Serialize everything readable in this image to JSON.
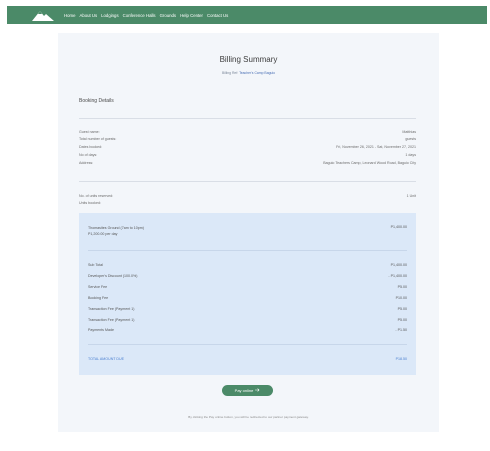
{
  "nav": {
    "logo_icon": "mountain-logo-icon",
    "items": [
      {
        "label": "Home"
      },
      {
        "label": "About Us"
      },
      {
        "label": "Lodgings"
      },
      {
        "label": "Conference Halls"
      },
      {
        "label": "Grounds"
      },
      {
        "label": "Help Center"
      },
      {
        "label": "Contact Us"
      }
    ]
  },
  "header": {
    "title": "Billing Summary",
    "subtitle_prefix": "Billing Ref: ",
    "reference": "Teacher's Camp Baguio"
  },
  "booking": {
    "section_label": "Booking Details",
    "rows": [
      {
        "label": "Guest name:",
        "value": "Matthias"
      },
      {
        "label": "Total number of guests:",
        "value": "guests"
      },
      {
        "label": "Dates booked:",
        "value": "Fri, November 26, 2021 - Sat, November 27, 2021"
      },
      {
        "label": "No of days:",
        "value": "1 days"
      },
      {
        "label": "Address:",
        "value": "Baguio Teachers Camp, Leonard Wood Road, Baguio City"
      }
    ],
    "units_reserved_label": "No. of units reserved:",
    "units_reserved_value": "1 Unit",
    "units_booked_label": "Units booked:"
  },
  "summary": {
    "item_name": "Thomasites Ground (7am to 10pm)",
    "item_rate": "P1,200.00 per day",
    "item_price": "P1,400.00",
    "lines": [
      {
        "label": "Sub Total",
        "value": "P1,400.00"
      },
      {
        "label": "Developer's Discount (100.0%)",
        "value": "- P1,400.00"
      },
      {
        "label": "Service Fee",
        "value": "P5.00"
      },
      {
        "label": "Booking Fee",
        "value": "P10.00"
      },
      {
        "label": "Transaction Fee (Payment 1)",
        "value": "P5.00"
      },
      {
        "label": "Transaction Fee (Payment 1)",
        "value": "P5.00"
      },
      {
        "label": "Payments Made",
        "value": "- P1.50"
      }
    ],
    "total_label": "TOTAL AMOUNT DUE",
    "total_value": "P18.50"
  },
  "actions": {
    "pay_label": "Pay online",
    "pay_icon": "arrow-right-icon"
  },
  "footnote": "By clicking the Pay online button, you will be redirected to our partner payment gateway."
}
